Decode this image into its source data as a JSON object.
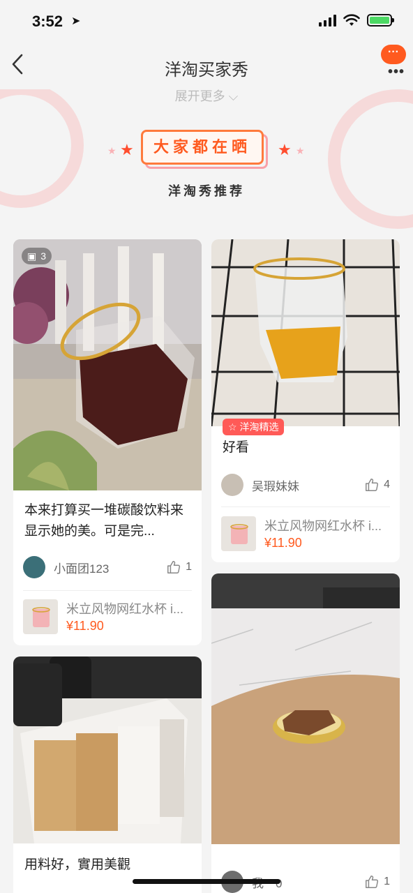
{
  "status_bar": {
    "time": "3:52",
    "location_arrow": "➤"
  },
  "nav": {
    "back_icon": "‹",
    "title": "洋淘买家秀",
    "more_bubble": "···",
    "more_dots": "•••"
  },
  "banner": {
    "expand_label": "展开更多 ⌵",
    "badge_label": "大家都在晒",
    "subtitle": "洋淘秀推荐",
    "star_glyph": "★"
  },
  "posts": [
    {
      "image_count": "3",
      "text": "本来打算买一堆碳酸饮料来显示她的美。可是完...",
      "user_name": "小面团123",
      "likes": "1",
      "product_name": "米立风物网红水杯 i...",
      "product_price": "¥11.90"
    },
    {
      "tag": "洋淘精选",
      "text": "好看",
      "user_name": "吴瑕妹妹",
      "likes": "4",
      "product_name": "米立风物网红水杯 i...",
      "product_price": "¥11.90"
    },
    {
      "text": "用料好，實用美觀"
    },
    {
      "user_name": "我一0",
      "likes": "1"
    }
  ],
  "colors": {
    "accent": "#ff5a1f",
    "tag_bg": "#ff5a57",
    "page_bg": "#f4f4f4"
  }
}
